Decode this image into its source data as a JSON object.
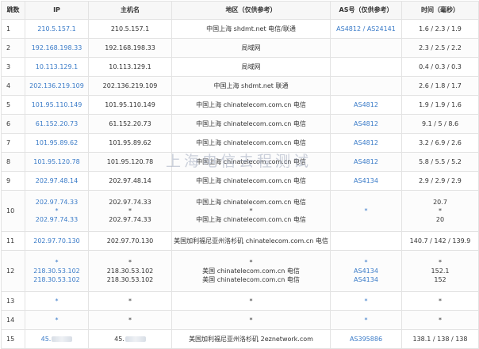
{
  "headers": [
    "跳数",
    "IP",
    "主机名",
    "地区（仅供参考）",
    "AS号（仅供参考）",
    "时间（毫秒）"
  ],
  "watermark": "上海电信去程测试",
  "colors": {
    "link": "#3a7bc8",
    "text": "#333333",
    "border": "#e3e3e3"
  },
  "rows": [
    {
      "hop": "1",
      "ip": [
        "210.5.157.1"
      ],
      "host": [
        "210.5.157.1"
      ],
      "loc": [
        "中国上海 shdmt.net 电信/联通"
      ],
      "as": [
        "AS4812 / AS24141"
      ],
      "time": [
        "1.6 / 2.3 / 1.9"
      ]
    },
    {
      "hop": "2",
      "ip": [
        "192.168.198.33"
      ],
      "host": [
        "192.168.198.33"
      ],
      "loc": [
        "局域网"
      ],
      "as": [
        ""
      ],
      "time": [
        "2.3 / 2.5 / 2.2"
      ]
    },
    {
      "hop": "3",
      "ip": [
        "10.113.129.1"
      ],
      "host": [
        "10.113.129.1"
      ],
      "loc": [
        "局域网"
      ],
      "as": [
        ""
      ],
      "time": [
        "0.4 / 0.3 / 0.3"
      ]
    },
    {
      "hop": "4",
      "ip": [
        "202.136.219.109"
      ],
      "host": [
        "202.136.219.109"
      ],
      "loc": [
        "中国上海 shdmt.net 联通"
      ],
      "as": [
        ""
      ],
      "time": [
        "2.6 / 1.8 / 1.7"
      ]
    },
    {
      "hop": "5",
      "ip": [
        "101.95.110.149"
      ],
      "host": [
        "101.95.110.149"
      ],
      "loc": [
        "中国上海 chinatelecom.com.cn 电信"
      ],
      "as": [
        "AS4812"
      ],
      "time": [
        "1.9 / 1.9 / 1.6"
      ]
    },
    {
      "hop": "6",
      "ip": [
        "61.152.20.73"
      ],
      "host": [
        "61.152.20.73"
      ],
      "loc": [
        "中国上海 chinatelecom.com.cn 电信"
      ],
      "as": [
        "AS4812"
      ],
      "time": [
        "9.1 / 5 / 8.6"
      ]
    },
    {
      "hop": "7",
      "ip": [
        "101.95.89.62"
      ],
      "host": [
        "101.95.89.62"
      ],
      "loc": [
        "中国上海 chinatelecom.com.cn 电信"
      ],
      "as": [
        "AS4812"
      ],
      "time": [
        "3.2 / 6.9 / 2.6"
      ]
    },
    {
      "hop": "8",
      "ip": [
        "101.95.120.78"
      ],
      "host": [
        "101.95.120.78"
      ],
      "loc": [
        "中国上海 chinatelecom.com.cn 电信"
      ],
      "as": [
        "AS4812"
      ],
      "time": [
        "5.8 / 5.5 / 5.2"
      ]
    },
    {
      "hop": "9",
      "ip": [
        "202.97.48.14"
      ],
      "host": [
        "202.97.48.14"
      ],
      "loc": [
        "中国上海 chinatelecom.com.cn 电信"
      ],
      "as": [
        "AS4134"
      ],
      "time": [
        "2.9 / 2.9 / 2.9"
      ]
    },
    {
      "hop": "10",
      "ip": [
        "202.97.74.33",
        "*",
        "202.97.74.33"
      ],
      "host": [
        "202.97.74.33",
        "*",
        "202.97.74.33"
      ],
      "loc": [
        "中国上海 chinatelecom.com.cn 电信",
        "*",
        "中国上海 chinatelecom.com.cn 电信"
      ],
      "as": [
        "",
        "*",
        ""
      ],
      "time": [
        "20.7",
        "*",
        "20"
      ]
    },
    {
      "hop": "11",
      "ip": [
        "202.97.70.130"
      ],
      "host": [
        "202.97.70.130"
      ],
      "loc": [
        "美国加利福尼亚州洛杉矶 chinatelecom.com.cn 电信"
      ],
      "as": [
        ""
      ],
      "time": [
        "140.7 / 142 / 139.9"
      ]
    },
    {
      "hop": "12",
      "ip": [
        "*",
        "218.30.53.102",
        "218.30.53.102"
      ],
      "host": [
        "*",
        "218.30.53.102",
        "218.30.53.102"
      ],
      "loc": [
        "*",
        "美国 chinatelecom.com.cn 电信",
        "美国 chinatelecom.com.cn 电信"
      ],
      "as": [
        "*",
        "AS4134",
        "AS4134"
      ],
      "time": [
        "*",
        "152.1",
        "152"
      ]
    },
    {
      "hop": "13",
      "ip": [
        "*"
      ],
      "host": [
        "*"
      ],
      "loc": [
        "*"
      ],
      "as": [
        "*"
      ],
      "time": [
        "*"
      ]
    },
    {
      "hop": "14",
      "ip": [
        "*"
      ],
      "host": [
        "*"
      ],
      "loc": [
        "*"
      ],
      "as": [
        "*"
      ],
      "time": [
        "*"
      ]
    },
    {
      "hop": "15",
      "ip": [
        "45."
      ],
      "host": [
        "45."
      ],
      "loc": [
        "美国加利福尼亚州洛杉矶 2eznetwork.com"
      ],
      "as": [
        "AS395886"
      ],
      "time": [
        "138.1 / 138 / 138"
      ]
    }
  ]
}
